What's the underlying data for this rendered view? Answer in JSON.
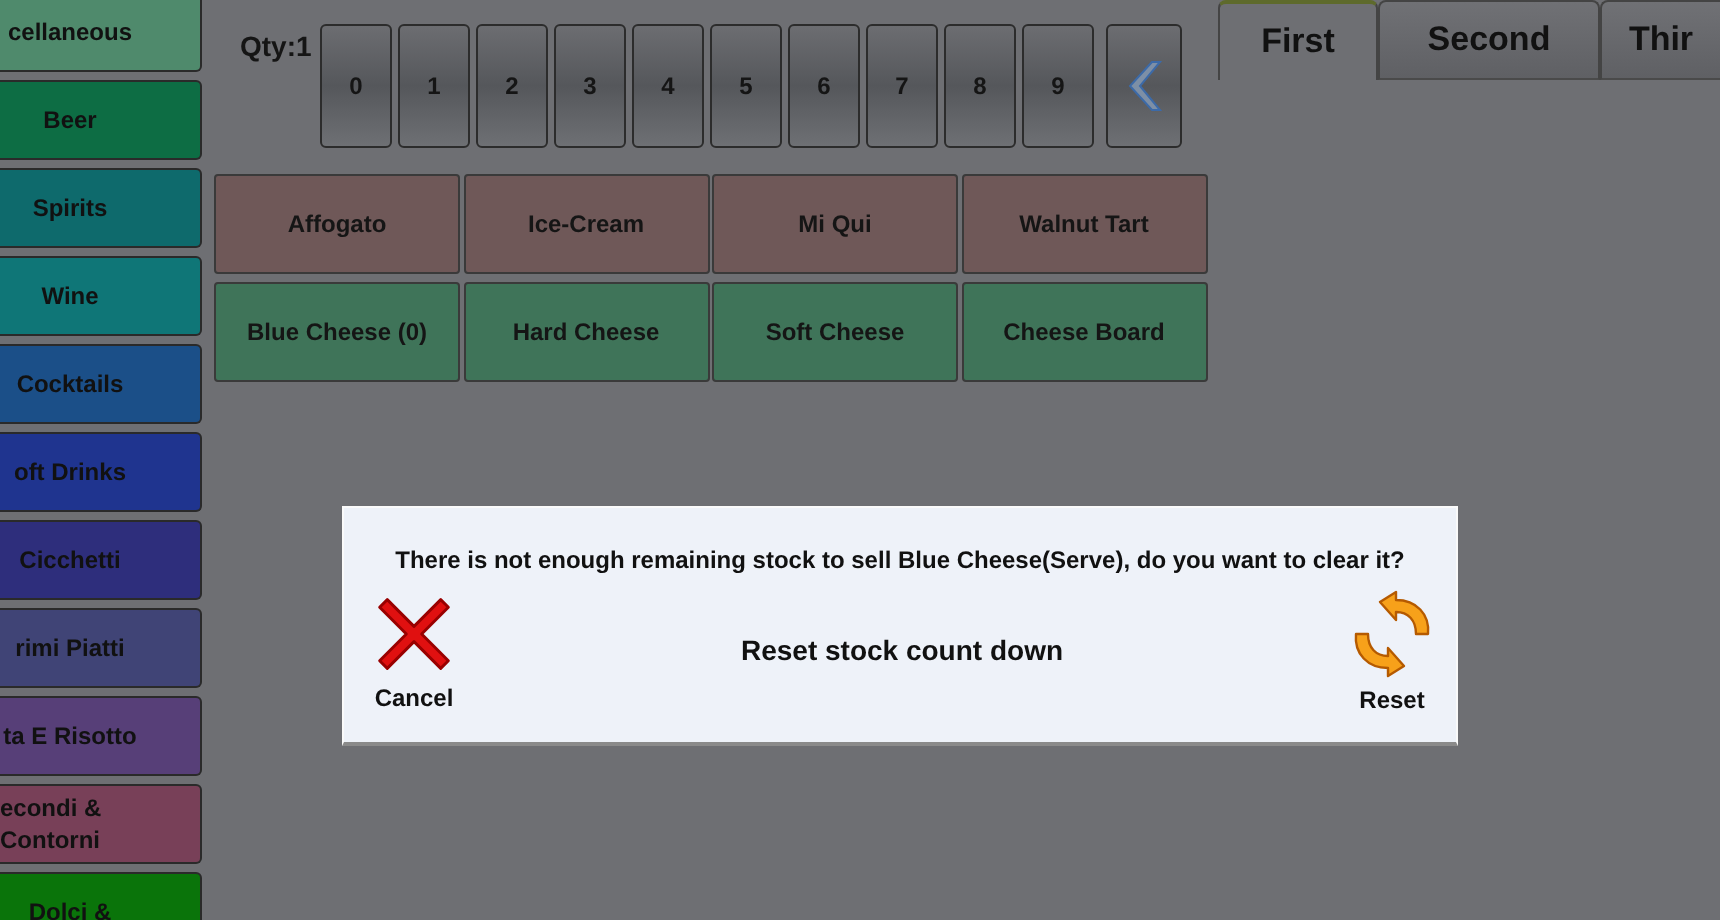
{
  "sidebar": {
    "items": [
      {
        "label": "cellaneous",
        "color": "#4f8a6c"
      },
      {
        "label": "Beer",
        "color": "#0d6d44"
      },
      {
        "label": "Spirits",
        "color": "#0e6a6c"
      },
      {
        "label": "Wine",
        "color": "#0f7677"
      },
      {
        "label": "Cocktails",
        "color": "#1b4f88"
      },
      {
        "label": "oft Drinks",
        "color": "#1f348f"
      },
      {
        "label": "Cicchetti",
        "color": "#2e2e7c"
      },
      {
        "label": "rimi Piatti",
        "color": "#404476"
      },
      {
        "label": "ta E Risotto",
        "color": "#573f78"
      },
      {
        "label": "econdi & Contorni",
        "color": "#784058"
      },
      {
        "label": "Dolci &",
        "color": "#0a740a"
      }
    ]
  },
  "quantity": {
    "label": "Qty:1"
  },
  "keypad": {
    "keys": [
      "0",
      "1",
      "2",
      "3",
      "4",
      "5",
      "6",
      "7",
      "8",
      "9"
    ]
  },
  "tabs": [
    {
      "label": "First",
      "selected": true
    },
    {
      "label": "Second",
      "selected": false
    },
    {
      "label": "Thir",
      "selected": false
    }
  ],
  "menu_items": [
    {
      "label": "Affogato",
      "color": "#6f5858"
    },
    {
      "label": "Ice-Cream",
      "color": "#6f5858"
    },
    {
      "label": "Mi Qui",
      "color": "#6f5858"
    },
    {
      "label": "Walnut Tart",
      "color": "#6f5858"
    },
    {
      "label": "Blue Cheese (0)",
      "color": "#3f7459"
    },
    {
      "label": "Hard Cheese",
      "color": "#3f7459"
    },
    {
      "label": "Soft Cheese",
      "color": "#3f7459"
    },
    {
      "label": "Cheese Board",
      "color": "#3f7459"
    }
  ],
  "dialog": {
    "message": "There is not enough remaining stock to sell Blue Cheese(Serve), do you want to clear it?",
    "title": "Reset stock count down",
    "cancel_label": "Cancel",
    "reset_label": "Reset"
  }
}
